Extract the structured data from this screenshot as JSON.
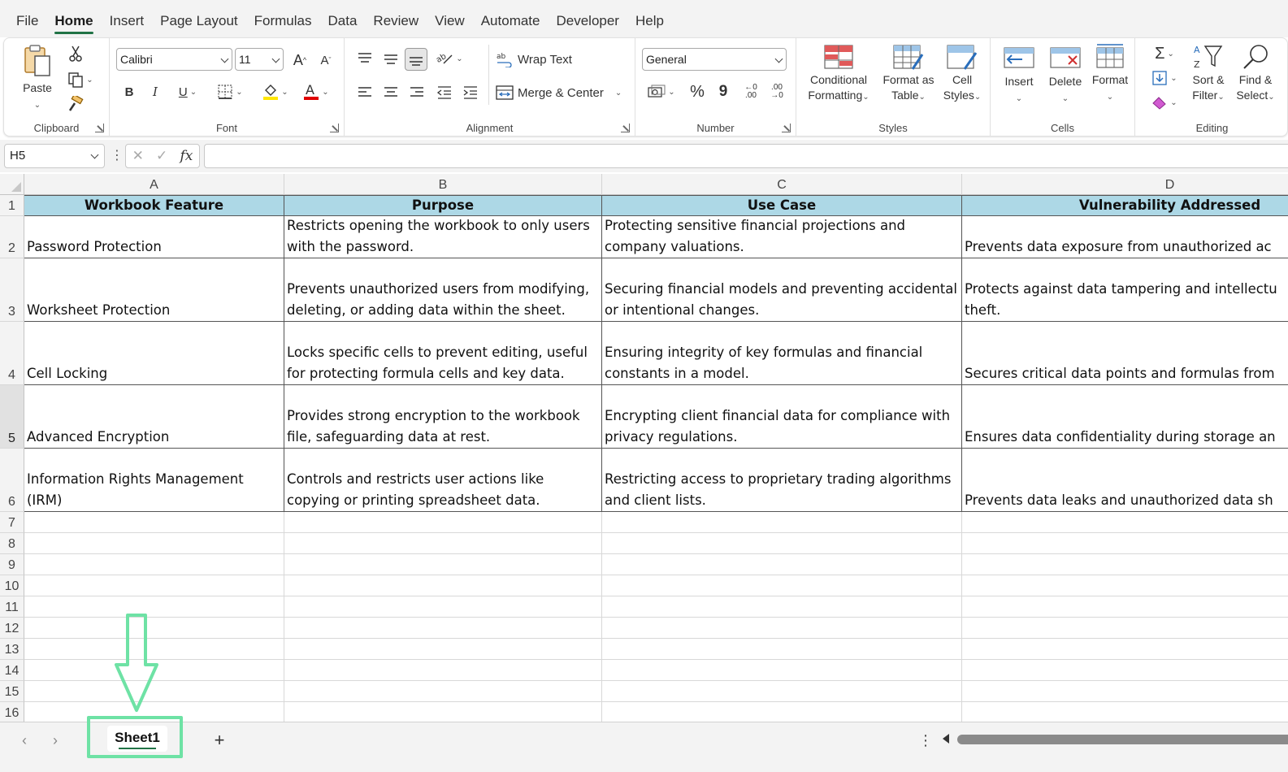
{
  "menu": {
    "tabs": [
      "File",
      "Home",
      "Insert",
      "Page Layout",
      "Formulas",
      "Data",
      "Review",
      "View",
      "Automate",
      "Developer",
      "Help"
    ],
    "active": "Home"
  },
  "ribbon": {
    "clipboard": {
      "label": "Clipboard",
      "paste": "Paste"
    },
    "font": {
      "label": "Font",
      "family": "Calibri",
      "size": "11",
      "bold": "B",
      "italic": "I",
      "underline": "U",
      "grow": "A",
      "shrink": "A"
    },
    "alignment": {
      "label": "Alignment",
      "wrap_text": "Wrap Text",
      "merge_center": "Merge & Center"
    },
    "number": {
      "label": "Number",
      "format": "General",
      "percent": "%",
      "comma": "9",
      "inc_decimal": ".00",
      "dec_decimal": ".00"
    },
    "styles": {
      "label": "Styles",
      "conditional_1": "Conditional",
      "conditional_2": "Formatting",
      "format_table_1": "Format as",
      "format_table_2": "Table",
      "cell_styles_1": "Cell",
      "cell_styles_2": "Styles"
    },
    "cells": {
      "label": "Cells",
      "insert": "Insert",
      "delete": "Delete",
      "format": "Format"
    },
    "editing": {
      "label": "Editing",
      "sort_1": "Sort &",
      "sort_2": "Filter",
      "find_1": "Find &",
      "find_2": "Select"
    }
  },
  "formula_bar": {
    "name_box": "H5",
    "fx": "fx",
    "value": ""
  },
  "columns": [
    {
      "letter": "A"
    },
    {
      "letter": "B"
    },
    {
      "letter": "C"
    },
    {
      "letter": "D"
    }
  ],
  "rows": [
    "1",
    "2",
    "3",
    "4",
    "5",
    "6",
    "7",
    "8",
    "9",
    "10",
    "11",
    "12",
    "13",
    "14",
    "15",
    "16"
  ],
  "table": {
    "headers": [
      "Workbook Feature",
      "Purpose",
      "Use Case",
      "Vulnerability Addressed"
    ],
    "data": [
      [
        "Password Protection",
        "Restricts opening the workbook to only users\nwith the password.",
        "Protecting sensitive financial projections and\ncompany valuations.",
        "Prevents data exposure from unauthorized ac"
      ],
      [
        "Worksheet Protection",
        "Prevents unauthorized users from modifying,\ndeleting, or adding data within the sheet.",
        "Securing financial models and preventing accidental\nor intentional changes.",
        "Protects against data tampering and intellectu\ntheft."
      ],
      [
        "Cell Locking",
        "Locks specific cells to prevent editing, useful\nfor protecting formula cells and key data.",
        "Ensuring integrity of key formulas and financial\nconstants in a model.",
        "Secures critical data points and formulas from"
      ],
      [
        "Advanced Encryption",
        "Provides strong encryption to the workbook\nfile, safeguarding data at rest.",
        "Encrypting client financial data for compliance with\nprivacy regulations.",
        "Ensures data confidentiality during storage an"
      ],
      [
        "Information Rights Management\n(IRM)",
        "Controls and restricts user actions like\ncopying or printing spreadsheet data.",
        "Restricting access to proprietary trading algorithms\nand client lists.",
        "Prevents data leaks and unauthorized data sh"
      ]
    ]
  },
  "sheets": {
    "tabs": [
      "Sheet1"
    ],
    "add": "+"
  },
  "annotation": {
    "color": "#6ee2a5"
  },
  "colors": {
    "header_fill": "#add8e6",
    "accent": "#217346"
  }
}
